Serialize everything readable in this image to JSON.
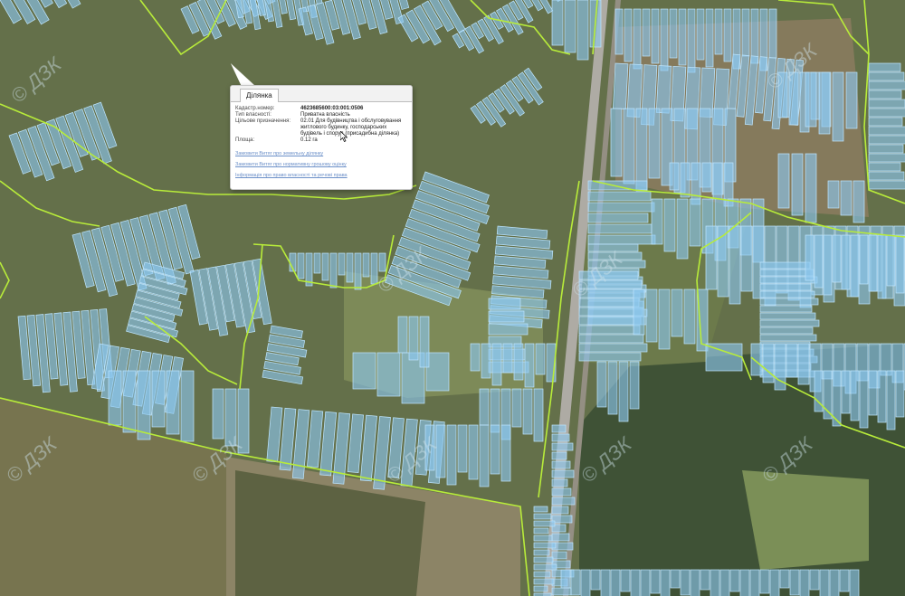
{
  "colors": {
    "parcel_fill": "#8cc8f0",
    "parcel_stroke": "#bfe6ff",
    "boundary": "#b8ec3a",
    "field_green": "#6a7a4a",
    "forest": "#3f5236",
    "ploughed": "#8a7e63",
    "road": "#b0aea8"
  },
  "watermark": "© ДЗК",
  "popup": {
    "tab_label": "Ділянка",
    "fields": [
      {
        "key": "Кадастр.номер:",
        "value": "4623685600:03:001:0506"
      },
      {
        "key": "Тип власності:",
        "value": "Приватна власність"
      },
      {
        "key": "Цільове призначення:",
        "value": "02.01 Для будівництва і обслуговування житлового будинку, господарських будівель і споруд (присадибна ділянка)"
      },
      {
        "key": "Площа:",
        "value": "0.12 га"
      }
    ],
    "links": [
      "Замовити Витяг про земельну ділянку",
      "Замовити Витяг про нормативну грошову оцінку",
      "Інформація про право власності та речові права"
    ]
  }
}
